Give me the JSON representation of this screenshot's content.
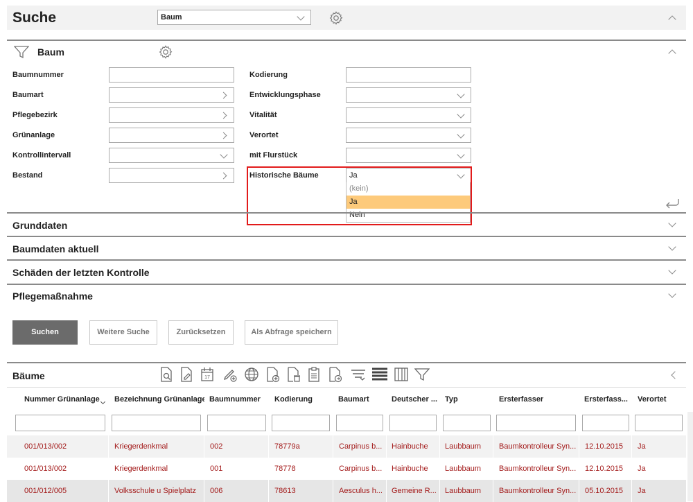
{
  "header": {
    "title": "Suche",
    "search_type": "Baum"
  },
  "baum_section": {
    "title": "Baum",
    "left_fields": [
      {
        "label": "Baumnummer",
        "value": ""
      },
      {
        "label": "Baumart",
        "value": ""
      },
      {
        "label": "Pflegebezirk",
        "value": ""
      },
      {
        "label": "Grünanlage",
        "value": ""
      },
      {
        "label": "Kontrollintervall",
        "value": ""
      },
      {
        "label": "Bestand",
        "value": ""
      }
    ],
    "right_fields": [
      {
        "label": "Kodierung",
        "value": ""
      },
      {
        "label": "Entwicklungsphase",
        "value": ""
      },
      {
        "label": "Vitalität",
        "value": ""
      },
      {
        "label": "Verortet",
        "value": ""
      },
      {
        "label": "mit Flurstück",
        "value": ""
      },
      {
        "label": "Historische Bäume",
        "value": "Ja"
      }
    ],
    "dropdown_options": [
      "(kein)",
      "Ja",
      "Nein"
    ],
    "dropdown_selected": "Ja"
  },
  "collapsed_sections": [
    "Grunddaten",
    "Baumdaten aktuell",
    "Schäden der letzten Kontrolle",
    "Pflegemaßnahme"
  ],
  "buttons": {
    "search": "Suchen",
    "further_search": "Weitere Suche",
    "reset": "Zurücksetzen",
    "save_query": "Als Abfrage speichern"
  },
  "results": {
    "title": "Bäume",
    "toolbar_icons": [
      "document-search-icon",
      "document-edit-icon",
      "calendar-icon",
      "pen-add-icon",
      "globe-icon",
      "document-add-icon",
      "document-delete-icon",
      "clipboard-icon",
      "document-export-icon",
      "filter-lines-icon",
      "list-icon",
      "columns-icon",
      "funnel-icon"
    ],
    "columns": [
      "Nummer Grünanlage",
      "Bezeichnung Grünanlage",
      "Baumnummer",
      "Kodierung",
      "Baumart",
      "Deutscher ...",
      "Typ",
      "Ersterfasser",
      "Ersterfass...",
      "Verortet"
    ],
    "rows": [
      [
        "001/013/002",
        "Kriegerdenkmal",
        "002",
        "78779a",
        "Carpinus b...",
        "Hainbuche",
        "Laubbaum",
        "Baumkontrolleur Syn...",
        "12.10.2015",
        "Ja"
      ],
      [
        "001/013/002",
        "Kriegerdenkmal",
        "001",
        "78778",
        "Carpinus b...",
        "Hainbuche",
        "Laubbaum",
        "Baumkontrolleur Syn...",
        "12.10.2015",
        "Ja"
      ],
      [
        "001/012/005",
        "Volksschule u Spielplatz",
        "006",
        "78613",
        "Aesculus h...",
        "Gemeine R...",
        "Laubbaum",
        "Baumkontrolleur Syn...",
        "05.10.2015",
        "Ja"
      ]
    ]
  },
  "colors": {
    "row_text": "#a31a1a",
    "highlight": "#e21b1b",
    "selected_option": "#fdca7b",
    "primary_button": "#6b6b6b"
  }
}
